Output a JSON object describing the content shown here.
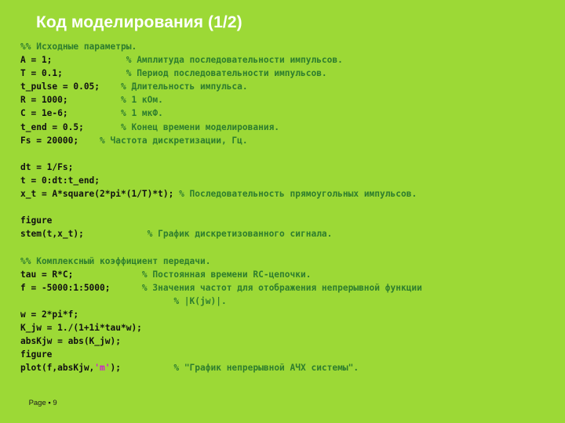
{
  "slide": {
    "title": "Код моделирования (1/2)",
    "background_color": "#9cd936",
    "title_color": "#ffffff",
    "code_color": "#111111",
    "comment_color": "#2e7d2e",
    "string_color": "#d11ad1"
  },
  "code": {
    "lines": [
      {
        "type": "comment",
        "text": "%% Исходные параметры."
      },
      {
        "type": "code",
        "code": "A = 1;",
        "pad": "              ",
        "comment": "% Амплитуда последовательности импульсов."
      },
      {
        "type": "code",
        "code": "T = 0.1;",
        "pad": "            ",
        "comment": "% Период последовательности импульсов."
      },
      {
        "type": "code",
        "code": "t_pulse = 0.05;",
        "pad": "    ",
        "comment": "% Длительность импульса."
      },
      {
        "type": "code",
        "code": "R = 1000;",
        "pad": "          ",
        "comment": "% 1 кОм."
      },
      {
        "type": "code",
        "code": "C = 1e-6;",
        "pad": "          ",
        "comment": "% 1 мкФ."
      },
      {
        "type": "code",
        "code": "t_end = 0.5;",
        "pad": "       ",
        "comment": "% Конец времени моделирования."
      },
      {
        "type": "code",
        "code": "Fs = 20000;",
        "pad": "    ",
        "comment": "% Частота дискретизации, Гц."
      },
      {
        "type": "blank"
      },
      {
        "type": "code",
        "code": "dt = 1/Fs;",
        "pad": "",
        "comment": ""
      },
      {
        "type": "code",
        "code": "t = 0:dt:t_end;",
        "pad": "",
        "comment": ""
      },
      {
        "type": "wrap",
        "code": "x_t = A*square(2*pi*(1/T)*t);",
        "pad": " ",
        "comment": "% Последовательность прямоугольных импульсов."
      },
      {
        "type": "blank"
      },
      {
        "type": "code",
        "code": "figure",
        "pad": "",
        "comment": ""
      },
      {
        "type": "code",
        "code": "stem(t,x_t);",
        "pad": "            ",
        "comment": "% График дискретизованного сигнала."
      },
      {
        "type": "blank"
      },
      {
        "type": "comment",
        "text": "%% Комплексный коэффициент передачи."
      },
      {
        "type": "code",
        "code": "tau = R*C;",
        "pad": "             ",
        "comment": "% Постоянная времени RC-цепочки."
      },
      {
        "type": "wrap",
        "code": "f = -5000:1:5000;",
        "pad": "      ",
        "comment": "% Значения частот для отображения непрерывной функции"
      },
      {
        "type": "comment-indent",
        "text": "% |K(jw)|.",
        "indent": "                             "
      },
      {
        "type": "code",
        "code": "w = 2*pi*f;",
        "pad": "",
        "comment": ""
      },
      {
        "type": "code",
        "code": "K_jw = 1./(1+1i*tau*w);",
        "pad": "",
        "comment": ""
      },
      {
        "type": "code",
        "code": "absKjw = abs(K_jw);",
        "pad": "",
        "comment": ""
      },
      {
        "type": "code",
        "code": "figure",
        "pad": "",
        "comment": ""
      },
      {
        "type": "string-code",
        "code_pre": "plot(f,absKjw,",
        "string": "'m'",
        "code_post": ");",
        "pad": "          ",
        "comment": "% \"График непрерывной АЧХ системы\"."
      }
    ]
  },
  "footer": {
    "label": "Page",
    "separator": "▪",
    "number": "9"
  }
}
